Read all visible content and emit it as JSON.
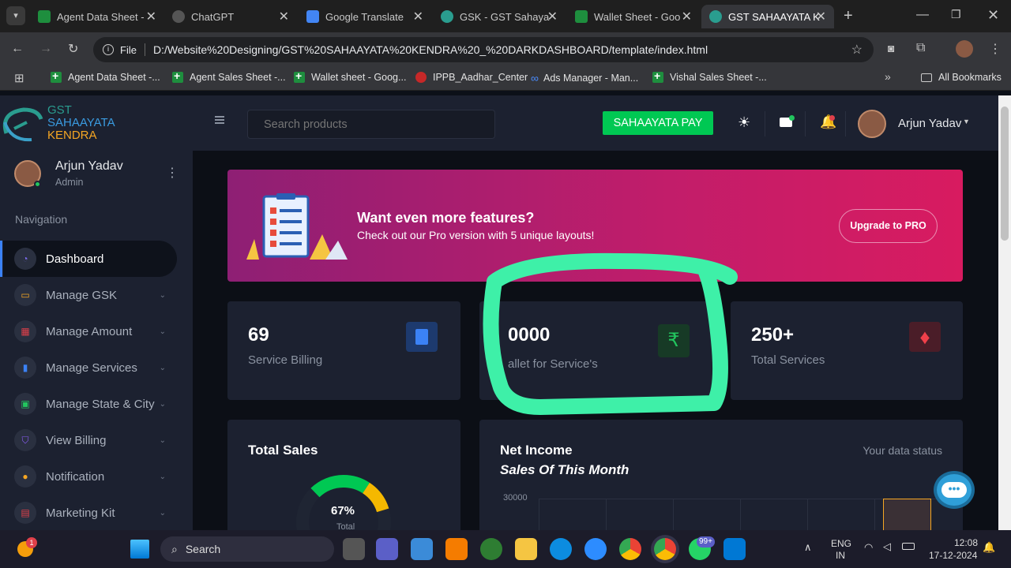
{
  "browser": {
    "tabs": [
      {
        "label": "Agent Data Sheet -",
        "color": "#1e8e3e"
      },
      {
        "label": "ChatGPT",
        "color": "#444"
      },
      {
        "label": "Google Translate",
        "color": "#4285f4"
      },
      {
        "label": "GSK - GST Sahaya",
        "color": "#2a9d8f"
      },
      {
        "label": "Wallet Sheet - Goo",
        "color": "#1e8e3e"
      },
      {
        "label": "GST SAHAAYATA K",
        "color": "#2a9d8f"
      }
    ],
    "url_prefix": "File",
    "url": "D:/Website%20Designing/GST%20SAHAAYATA%20KENDRA%20_%20DARKDASHBOARD/template/index.html",
    "bookmarks": [
      "Agent Data Sheet -...",
      "Agent Sales Sheet -...",
      "Wallet sheet - Goog...",
      "IPPB_Aadhar_Center",
      "Ads Manager - Man...",
      "Vishal Sales Sheet -..."
    ],
    "all_bookmarks": "All Bookmarks"
  },
  "brand": {
    "line1": "GST",
    "line2": "SAHAAYATA",
    "line3": "KENDRA"
  },
  "profile": {
    "name": "Arjun Yadav",
    "role": "Admin"
  },
  "nav": {
    "heading": "Navigation",
    "items": [
      {
        "label": "Dashboard",
        "color": "#7c6cf0"
      },
      {
        "label": "Manage GSK",
        "color": "#f5a623"
      },
      {
        "label": "Manage Amount",
        "color": "#e0404a"
      },
      {
        "label": "Manage Services",
        "color": "#3b82f6"
      },
      {
        "label": "Manage State & City",
        "color": "#22c55e"
      },
      {
        "label": "View Billing",
        "color": "#8b5cf6"
      },
      {
        "label": "Notification",
        "color": "#f5a623"
      },
      {
        "label": "Marketing Kit",
        "color": "#e0404a"
      }
    ]
  },
  "topbar": {
    "search_placeholder": "Search products",
    "pay_button": "SAHAAYATA PAY",
    "user": "Arjun Yadav"
  },
  "banner": {
    "title": "Want even more features?",
    "subtitle": "Check out our Pro version with 5 unique layouts!",
    "button": "Upgrade to PRO"
  },
  "stats": [
    {
      "value": "69",
      "label": "Service Billing"
    },
    {
      "value": "0000",
      "label": "allet for Service's"
    },
    {
      "value": "250+",
      "label": "Total Services"
    }
  ],
  "total_sales": {
    "title": "Total Sales",
    "percent": "67%",
    "sub": "Total"
  },
  "net_income": {
    "title": "Net Income",
    "subtitle": "Sales Of This Month",
    "status": "Your data status",
    "y_tick": "30000"
  },
  "taskbar": {
    "search": "Search",
    "lang1": "ENG",
    "lang2": "IN",
    "time": "12:08",
    "date": "17-12-2024",
    "badge": "99+",
    "notif_badge": "1"
  },
  "colors": {
    "accent": "#7c6cf0",
    "green": "#00c853",
    "banner_start": "#8e1f74",
    "banner_end": "#d81b60",
    "highlight": "#3ef0a8"
  }
}
